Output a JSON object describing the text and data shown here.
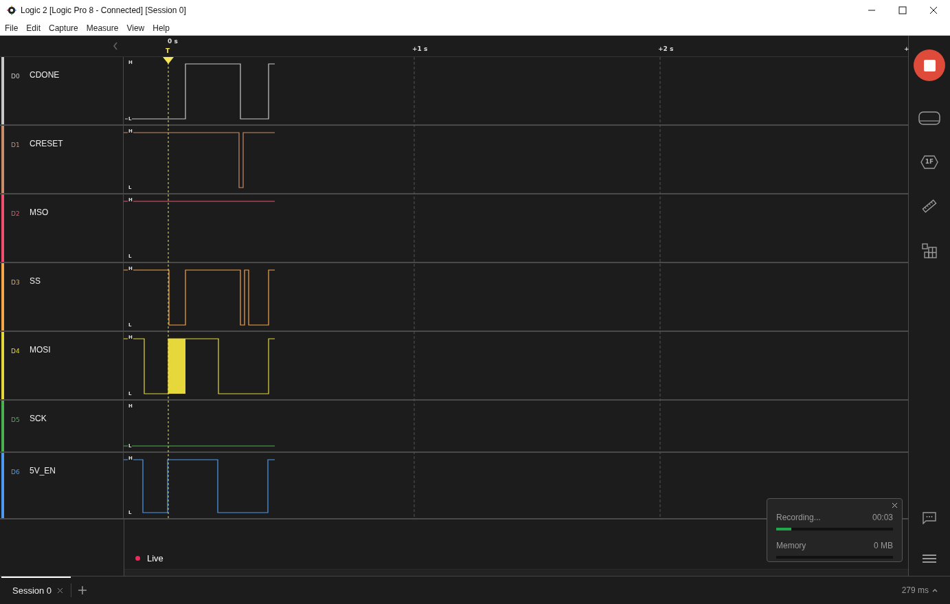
{
  "window": {
    "title": "Logic 2 [Logic Pro 8 - Connected] [Session 0]"
  },
  "menu": [
    "File",
    "Edit",
    "Capture",
    "Measure",
    "View",
    "Help"
  ],
  "ruler": {
    "labels": [
      "0 s",
      "+1 s",
      "+2 s",
      "+"
    ],
    "trigger": "T"
  },
  "channels": [
    {
      "id": "D0",
      "name": "CDONE",
      "color": "#c8c8c8",
      "high_label": "H",
      "low_label": "L"
    },
    {
      "id": "D1",
      "name": "CRESET",
      "color": "#c98d6a",
      "high_label": "H",
      "low_label": "L"
    },
    {
      "id": "D2",
      "name": "MSO",
      "color": "#f0506e",
      "high_label": "H",
      "low_label": "L"
    },
    {
      "id": "D3",
      "name": "SS",
      "color": "#f5a64a",
      "high_label": "H",
      "low_label": "L"
    },
    {
      "id": "D4",
      "name": "MOSI",
      "color": "#e6d83a",
      "high_label": "H",
      "low_label": "L"
    },
    {
      "id": "D5",
      "name": "SCK",
      "color": "#4caf50",
      "high_label": "H",
      "low_label": "L"
    },
    {
      "id": "D6",
      "name": "5V_EN",
      "color": "#4d9bf0",
      "high_label": "H",
      "low_label": "L"
    }
  ],
  "live": {
    "label": "Live"
  },
  "sidebar": {
    "analyzer_icon_text": "1F"
  },
  "recording_popup": {
    "recording": {
      "status": "Recording...",
      "time": "00:03",
      "level": 0.13
    },
    "memory": {
      "label": "Memory",
      "value": "0 MB"
    }
  },
  "session_tabs": [
    {
      "label": "Session 0",
      "selected": true
    }
  ],
  "status": {
    "timing": "279 ms"
  }
}
